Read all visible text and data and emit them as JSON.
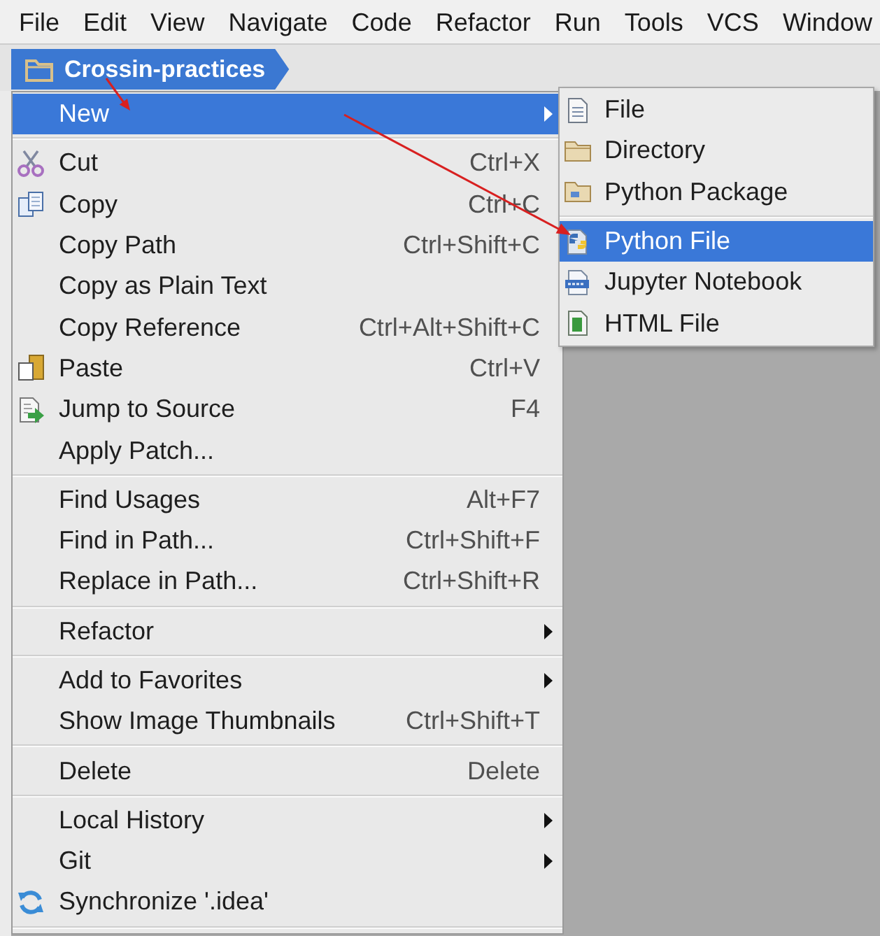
{
  "menu_bar": {
    "items": [
      "File",
      "Edit",
      "View",
      "Navigate",
      "Code",
      "Refactor",
      "Run",
      "Tools",
      "VCS",
      "Window"
    ]
  },
  "breadcrumb": {
    "label": "Crossin-practices"
  },
  "context_menu": {
    "items": [
      {
        "kind": "item",
        "label": "New",
        "selected": true,
        "has_submenu": true
      },
      {
        "kind": "separator"
      },
      {
        "kind": "item",
        "label": "Cut",
        "shortcut": "Ctrl+X",
        "selected": false,
        "has_submenu": false
      },
      {
        "kind": "item",
        "label": "Copy",
        "shortcut": "Ctrl+C",
        "selected": false,
        "has_submenu": false
      },
      {
        "kind": "item",
        "label": "Copy Path",
        "shortcut": "Ctrl+Shift+C",
        "selected": false,
        "has_submenu": false
      },
      {
        "kind": "item",
        "label": "Copy as Plain Text",
        "selected": false,
        "has_submenu": false
      },
      {
        "kind": "item",
        "label": "Copy Reference",
        "shortcut": "Ctrl+Alt+Shift+C",
        "selected": false,
        "has_submenu": false
      },
      {
        "kind": "item",
        "label": "Paste",
        "shortcut": "Ctrl+V",
        "selected": false,
        "has_submenu": false
      },
      {
        "kind": "item",
        "label": "Jump to Source",
        "shortcut": "F4",
        "selected": false,
        "has_submenu": false
      },
      {
        "kind": "item",
        "label": "Apply Patch...",
        "selected": false,
        "has_submenu": false
      },
      {
        "kind": "separator"
      },
      {
        "kind": "item",
        "label": "Find Usages",
        "shortcut": "Alt+F7",
        "selected": false,
        "has_submenu": false
      },
      {
        "kind": "item",
        "label": "Find in Path...",
        "shortcut": "Ctrl+Shift+F",
        "selected": false,
        "has_submenu": false
      },
      {
        "kind": "item",
        "label": "Replace in Path...",
        "shortcut": "Ctrl+Shift+R",
        "selected": false,
        "has_submenu": false
      },
      {
        "kind": "separator"
      },
      {
        "kind": "item",
        "label": "Refactor",
        "selected": false,
        "has_submenu": true
      },
      {
        "kind": "separator"
      },
      {
        "kind": "item",
        "label": "Add to Favorites",
        "selected": false,
        "has_submenu": true
      },
      {
        "kind": "item",
        "label": "Show Image Thumbnails",
        "shortcut": "Ctrl+Shift+T",
        "selected": false,
        "has_submenu": false
      },
      {
        "kind": "separator"
      },
      {
        "kind": "item",
        "label": "Delete",
        "shortcut": "Delete",
        "selected": false,
        "has_submenu": false
      },
      {
        "kind": "separator"
      },
      {
        "kind": "item",
        "label": "Local History",
        "selected": false,
        "has_submenu": true
      },
      {
        "kind": "item",
        "label": "Git",
        "selected": false,
        "has_submenu": true
      },
      {
        "kind": "item",
        "label": "Synchronize '.idea'",
        "selected": false,
        "has_submenu": false
      },
      {
        "kind": "separator"
      }
    ]
  },
  "submenu": {
    "items": [
      {
        "kind": "item",
        "label": "File",
        "selected": false
      },
      {
        "kind": "item",
        "label": "Directory",
        "selected": false
      },
      {
        "kind": "item",
        "label": "Python Package",
        "selected": false
      },
      {
        "kind": "separator"
      },
      {
        "kind": "item",
        "label": "Python File",
        "selected": true
      },
      {
        "kind": "item",
        "label": "Jupyter Notebook",
        "selected": false
      },
      {
        "kind": "item",
        "label": "HTML File",
        "selected": false
      }
    ]
  }
}
